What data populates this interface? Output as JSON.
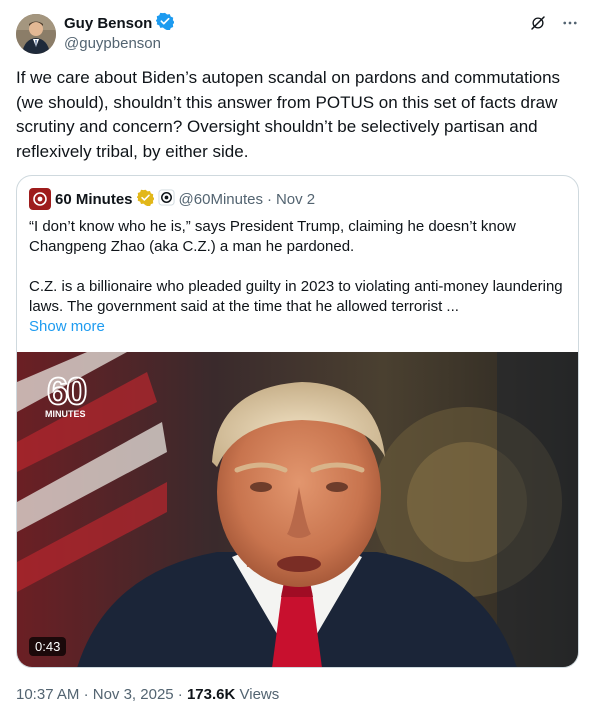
{
  "author": {
    "name": "Guy Benson",
    "handle": "@guypbenson",
    "verified_color": "#1d9bf0"
  },
  "tweet": {
    "text": "If we care about Biden’s autopen scandal on pardons and commutations (we should), shouldn’t this answer from POTUS on this set of facts draw scrutiny and concern? Oversight shouldn’t be selectively partisan and reflexively tribal, by either side."
  },
  "quote": {
    "name": "60 Minutes",
    "handle": "@60Minutes",
    "date": "Nov 2",
    "para1": "“I don’t know who he is,” says President Trump, claiming he doesn’t know Changpeng Zhao (aka C.Z.) a man he pardoned.",
    "para2": "C.Z. is a billionaire who pleaded guilty in 2023 to violating anti-money laundering laws. The government said at the time that he allowed terrorist ...",
    "show_more": "Show more",
    "badge_color": "#e2b719",
    "video": {
      "duration": "0:43",
      "logo_number": "60",
      "logo_word": "MINUTES"
    }
  },
  "footer": {
    "time": "10:37 AM",
    "date": "Nov 3, 2025",
    "views_count": "173.6K",
    "views_label": "Views"
  },
  "icons": {
    "grok": "grok-icon",
    "more": "more-icon"
  }
}
